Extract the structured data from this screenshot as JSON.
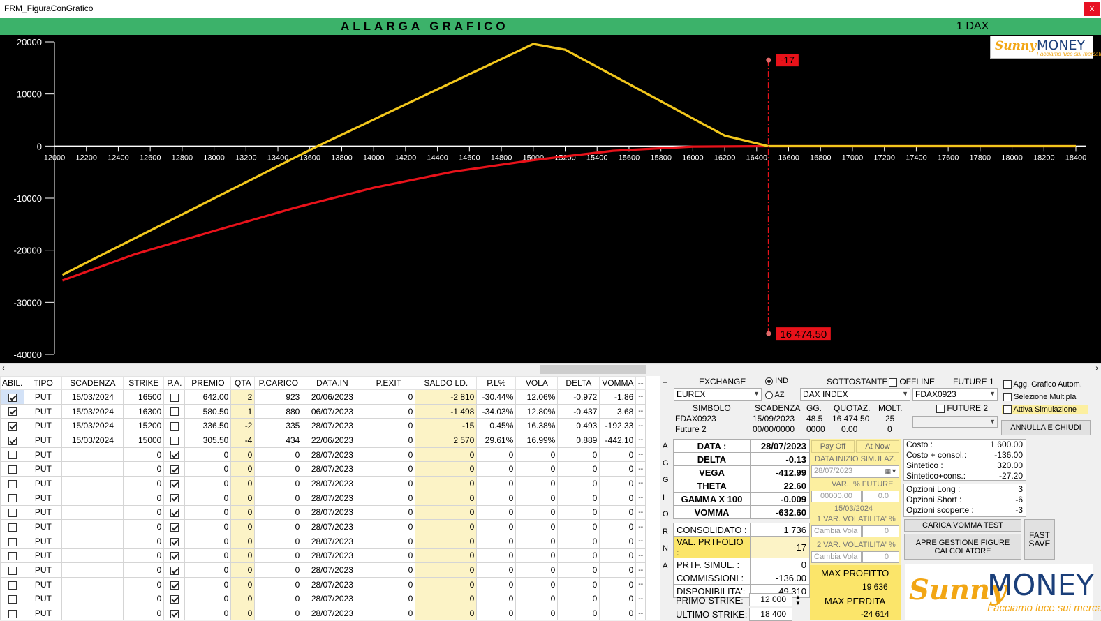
{
  "window": {
    "title": "FRM_FiguraConGrafico",
    "close": "x"
  },
  "header": {
    "expand_chart": "ALLARGA GRAFICO",
    "underlying_qty": "1 DAX"
  },
  "logo": {
    "script": "Sunny",
    "word": "MONEY",
    "tagline": "Facciamo luce sui mercati"
  },
  "chart_data": {
    "type": "line",
    "x_ticks": [
      "12000",
      "12200",
      "12400",
      "12600",
      "12800",
      "13000",
      "13200",
      "13400",
      "13600",
      "13800",
      "14000",
      "14200",
      "14400",
      "14600",
      "14800",
      "15000",
      "15200",
      "15400",
      "15600",
      "15800",
      "16000",
      "16200",
      "16400",
      "16600",
      "16800",
      "17000",
      "17200",
      "17400",
      "17600",
      "17800",
      "18000",
      "18200",
      "18400"
    ],
    "y_ticks": [
      "20000",
      "10000",
      "0",
      "-10000",
      "-20000",
      "-30000",
      "-40000"
    ],
    "xlim": [
      12000,
      18400
    ],
    "ylim": [
      -40000,
      20000
    ],
    "series": [
      {
        "color": "#f2c71c",
        "points": [
          [
            12050,
            -24700
          ],
          [
            13650,
            0
          ],
          [
            15000,
            19600
          ],
          [
            15200,
            18500
          ],
          [
            16200,
            2000
          ],
          [
            16474,
            -17
          ],
          [
            18400,
            -17
          ]
        ]
      },
      {
        "color": "#e8121a",
        "points": [
          [
            12050,
            -25800
          ],
          [
            12500,
            -20800
          ],
          [
            13000,
            -16300
          ],
          [
            13500,
            -11900
          ],
          [
            14000,
            -8000
          ],
          [
            14500,
            -4900
          ],
          [
            15000,
            -2700
          ],
          [
            15500,
            -900
          ],
          [
            16000,
            -100
          ],
          [
            16474,
            -17
          ],
          [
            18400,
            -17
          ]
        ]
      }
    ],
    "cursor": {
      "x": 16474.5,
      "top_label": "-17",
      "bottom_label": "16 474.50"
    }
  },
  "table": {
    "headers": [
      "ABIL.",
      "TIPO",
      "SCADENZA",
      "STRIKE",
      "P.A.",
      "PREMIO",
      "QTA",
      "P.CARICO",
      "DATA.IN",
      "P.EXIT",
      "SALDO LD.",
      "P.L%",
      "VOLA",
      "DELTA",
      "VOMMA",
      "--"
    ],
    "rows": [
      {
        "abil": true,
        "tipo": "PUT",
        "scad": "15/03/2024",
        "strike": "16500",
        "pa": false,
        "premio": "642.00",
        "qta": "2",
        "pcarico": "923",
        "datain": "20/06/2023",
        "pexit": "0",
        "saldo": "-2 810",
        "pl": "-30.44%",
        "vola": "12.06%",
        "delta": "-0.972",
        "vomma": "-1.86"
      },
      {
        "abil": true,
        "tipo": "PUT",
        "scad": "15/03/2024",
        "strike": "16300",
        "pa": false,
        "premio": "580.50",
        "qta": "1",
        "pcarico": "880",
        "datain": "06/07/2023",
        "pexit": "0",
        "saldo": "-1 498",
        "pl": "-34.03%",
        "vola": "12.80%",
        "delta": "-0.437",
        "vomma": "3.68"
      },
      {
        "abil": true,
        "tipo": "PUT",
        "scad": "15/03/2024",
        "strike": "15200",
        "pa": false,
        "premio": "336.50",
        "qta": "-2",
        "pcarico": "335",
        "datain": "28/07/2023",
        "pexit": "0",
        "saldo": "-15",
        "pl": "0.45%",
        "vola": "16.38%",
        "delta": "0.493",
        "vomma": "-192.33"
      },
      {
        "abil": true,
        "tipo": "PUT",
        "scad": "15/03/2024",
        "strike": "15000",
        "pa": false,
        "premio": "305.50",
        "qta": "-4",
        "pcarico": "434",
        "datain": "22/06/2023",
        "pexit": "0",
        "saldo": "2 570",
        "pl": "29.61%",
        "vola": "16.99%",
        "delta": "0.889",
        "vomma": "-442.10"
      },
      {
        "abil": false,
        "tipo": "PUT",
        "scad": "",
        "strike": "0",
        "pa": true,
        "premio": "0",
        "qta": "0",
        "pcarico": "0",
        "datain": "28/07/2023",
        "pexit": "0",
        "saldo": "0",
        "pl": "0",
        "vola": "0",
        "delta": "0",
        "vomma": "0"
      },
      {
        "abil": false,
        "tipo": "PUT",
        "scad": "",
        "strike": "0",
        "pa": true,
        "premio": "0",
        "qta": "0",
        "pcarico": "0",
        "datain": "28/07/2023",
        "pexit": "0",
        "saldo": "0",
        "pl": "0",
        "vola": "0",
        "delta": "0",
        "vomma": "0"
      },
      {
        "abil": false,
        "tipo": "PUT",
        "scad": "",
        "strike": "0",
        "pa": true,
        "premio": "0",
        "qta": "0",
        "pcarico": "0",
        "datain": "28/07/2023",
        "pexit": "0",
        "saldo": "0",
        "pl": "0",
        "vola": "0",
        "delta": "0",
        "vomma": "0"
      },
      {
        "abil": false,
        "tipo": "PUT",
        "scad": "",
        "strike": "0",
        "pa": true,
        "premio": "0",
        "qta": "0",
        "pcarico": "0",
        "datain": "28/07/2023",
        "pexit": "0",
        "saldo": "0",
        "pl": "0",
        "vola": "0",
        "delta": "0",
        "vomma": "0"
      },
      {
        "abil": false,
        "tipo": "PUT",
        "scad": "",
        "strike": "0",
        "pa": true,
        "premio": "0",
        "qta": "0",
        "pcarico": "0",
        "datain": "28/07/2023",
        "pexit": "0",
        "saldo": "0",
        "pl": "0",
        "vola": "0",
        "delta": "0",
        "vomma": "0"
      },
      {
        "abil": false,
        "tipo": "PUT",
        "scad": "",
        "strike": "0",
        "pa": true,
        "premio": "0",
        "qta": "0",
        "pcarico": "0",
        "datain": "28/07/2023",
        "pexit": "0",
        "saldo": "0",
        "pl": "0",
        "vola": "0",
        "delta": "0",
        "vomma": "0"
      },
      {
        "abil": false,
        "tipo": "PUT",
        "scad": "",
        "strike": "0",
        "pa": true,
        "premio": "0",
        "qta": "0",
        "pcarico": "0",
        "datain": "28/07/2023",
        "pexit": "0",
        "saldo": "0",
        "pl": "0",
        "vola": "0",
        "delta": "0",
        "vomma": "0"
      },
      {
        "abil": false,
        "tipo": "PUT",
        "scad": "",
        "strike": "0",
        "pa": true,
        "premio": "0",
        "qta": "0",
        "pcarico": "0",
        "datain": "28/07/2023",
        "pexit": "0",
        "saldo": "0",
        "pl": "0",
        "vola": "0",
        "delta": "0",
        "vomma": "0"
      },
      {
        "abil": false,
        "tipo": "PUT",
        "scad": "",
        "strike": "0",
        "pa": true,
        "premio": "0",
        "qta": "0",
        "pcarico": "0",
        "datain": "28/07/2023",
        "pexit": "0",
        "saldo": "0",
        "pl": "0",
        "vola": "0",
        "delta": "0",
        "vomma": "0"
      },
      {
        "abil": false,
        "tipo": "PUT",
        "scad": "",
        "strike": "0",
        "pa": true,
        "premio": "0",
        "qta": "0",
        "pcarico": "0",
        "datain": "28/07/2023",
        "pexit": "0",
        "saldo": "0",
        "pl": "0",
        "vola": "0",
        "delta": "0",
        "vomma": "0"
      },
      {
        "abil": false,
        "tipo": "PUT",
        "scad": "",
        "strike": "0",
        "pa": true,
        "premio": "0",
        "qta": "0",
        "pcarico": "0",
        "datain": "28/07/2023",
        "pexit": "0",
        "saldo": "0",
        "pl": "0",
        "vola": "0",
        "delta": "0",
        "vomma": "0"
      },
      {
        "abil": false,
        "tipo": "PUT",
        "scad": "",
        "strike": "0",
        "pa": true,
        "premio": "0",
        "qta": "0",
        "pcarico": "0",
        "datain": "28/07/2023",
        "pexit": "0",
        "saldo": "0",
        "pl": "0",
        "vola": "0",
        "delta": "0",
        "vomma": "0"
      }
    ],
    "dash": "--"
  },
  "aggiorna": [
    "A",
    "G",
    "G",
    "I",
    "O",
    "R",
    "N",
    "A"
  ],
  "panel": {
    "exchange_label": "EXCHANGE",
    "radio_ind": "IND",
    "radio_az": "AZ",
    "sottostante_label": "SOTTOSTANTE",
    "offline": "OFFLINE",
    "future1": "FUTURE 1",
    "exchange_value": "EUREX",
    "sottostante_value": "DAX INDEX",
    "future1_value": "FDAX0923",
    "col_simbolo": "SIMBOLO",
    "col_scadenza": "SCADENZA",
    "col_gg": "GG.",
    "col_quotaz": "QUOTAZ.",
    "col_molt": "MOLT.",
    "future2": "FUTURE 2",
    "row1": {
      "simbolo": "FDAX0923",
      "scadenza": "15/09/2023",
      "gg": "48.5",
      "quotaz": "16 474.50",
      "molt": "25"
    },
    "row2": {
      "simbolo": "Future 2",
      "scadenza": "00/00/0000",
      "gg": "0000",
      "quotaz": "0.00",
      "molt": "0"
    },
    "agg_grafico": "Agg. Grafico Autom.",
    "selezione_multipla": "Selezione Multipla",
    "attiva_simulazione": "Attiva Simulazione",
    "annulla": "ANNULLA E CHIUDI",
    "greeks": [
      {
        "k": "DATA :",
        "v": "28/07/2023"
      },
      {
        "k": "DELTA",
        "v": "-0.13"
      },
      {
        "k": "VEGA",
        "v": "-412.99"
      },
      {
        "k": "THETA",
        "v": "22.60"
      },
      {
        "k": "GAMMA X 100",
        "v": "-0.009"
      },
      {
        "k": "VOMMA",
        "v": "-632.60"
      }
    ],
    "payoff": "Pay Off",
    "atnow": "At Now",
    "data_inizio": "DATA INIZIO SIMULAZ.",
    "data_inizio_value": "28/07/2023",
    "var_future": "VAR.. % FUTURE",
    "var_future_a": "00000.00",
    "var_future_b": "0.0",
    "date2": "15/03/2024",
    "var_vol1": "1 VAR. VOLATILITA' %",
    "cambia_vola": "Cambia Vola",
    "zero": "0",
    "var_vol2": "2 VAR. VOLATILITA' %",
    "summary": [
      {
        "k": "CONSOLIDATO :",
        "v": "1 736"
      },
      {
        "k": "VAL. PRTFOLIO :",
        "v": "-17"
      },
      {
        "k": "PRTF. SIMUL. :",
        "v": "0"
      },
      {
        "k": "COMMISSIONI :",
        "v": "-136.00"
      },
      {
        "k": "DISPONIBILITA':",
        "v": "49 310"
      }
    ],
    "costs": [
      {
        "k": "Costo :",
        "v": "1 600.00"
      },
      {
        "k": "Costo + consol.:",
        "v": "-136.00"
      },
      {
        "k": "Sintetico :",
        "v": "320.00"
      },
      {
        "k": "Sintetico+cons.:",
        "v": "-27.20"
      }
    ],
    "options": [
      {
        "k": "Opzioni Long :",
        "v": "3"
      },
      {
        "k": "Opzioni Short :",
        "v": "-6"
      },
      {
        "k": "Opzioni scoperte :",
        "v": "-3"
      }
    ],
    "carica_vomma": "CARICA VOMMA TEST",
    "apre_gestione": "APRE GESTIONE FIGURE CALCOLATORE",
    "fast_save": "FAST SAVE",
    "max_profitto": "MAX PROFITTO",
    "max_profitto_v": "19 636",
    "max_perdita": "MAX PERDITA",
    "max_perdita_v": "-24 614",
    "primo_strike": "PRIMO STRIKE:",
    "primo_strike_v": "12 000",
    "ultimo_strike": "ULTIMO STRIKE:",
    "ultimo_strike_v": "18 400"
  },
  "colors": {
    "green": "#3cb26a",
    "payoff": "#f2c71c",
    "atnow": "#e8121a",
    "highlight": "#fcefa0"
  }
}
